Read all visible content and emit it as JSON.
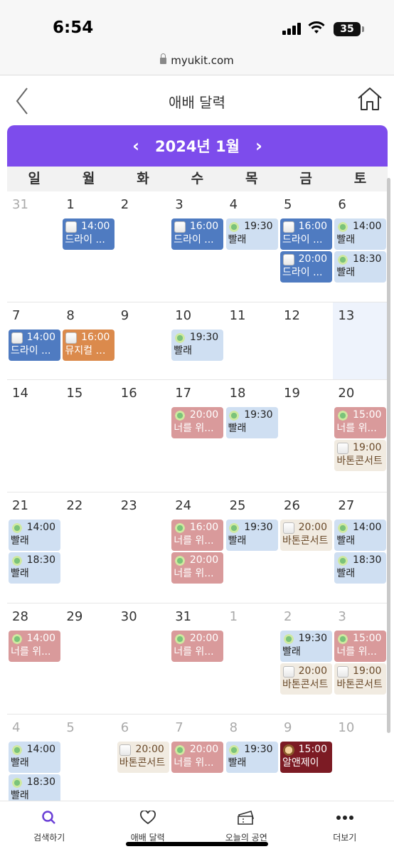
{
  "status": {
    "time": "6:54",
    "battery": "35"
  },
  "browser": {
    "url": "myukit.com"
  },
  "appbar": {
    "title": "애배 달력",
    "back_icon": "chevron-left-icon",
    "home_icon": "home-icon"
  },
  "calendar": {
    "month_label": "2024년 1월",
    "prev": "‹",
    "next": "›",
    "weekdays": [
      "일",
      "월",
      "화",
      "수",
      "목",
      "금",
      "토"
    ],
    "colors": {
      "purple": "#7d4cec",
      "blue_dark": "#4f7bc1",
      "blue_light": "#cfdff2",
      "orange": "#db8a4c",
      "pink": "#d99a9b",
      "beige": "#f1ebe1",
      "maroon": "#7c1b24"
    },
    "weeks": [
      {
        "days": [
          {
            "d": "31",
            "dim": true
          },
          {
            "d": "1"
          },
          {
            "d": "2"
          },
          {
            "d": "3"
          },
          {
            "d": "4"
          },
          {
            "d": "5"
          },
          {
            "d": "6"
          }
        ],
        "events": [
          {
            "col": 1,
            "slot": 0,
            "time": "14:00",
            "name": "드라이 ...",
            "icon": "cup",
            "style": "blue_dark"
          },
          {
            "col": 3,
            "slot": 0,
            "time": "16:00",
            "name": "드라이 ...",
            "icon": "cup",
            "style": "blue_dark"
          },
          {
            "col": 4,
            "slot": 0,
            "time": "19:30",
            "name": "빨래",
            "icon": "fairy",
            "style": "blue_light"
          },
          {
            "col": 5,
            "slot": 0,
            "time": "16:00",
            "name": "드라이 ...",
            "icon": "cup",
            "style": "blue_dark"
          },
          {
            "col": 5,
            "slot": 1,
            "time": "20:00",
            "name": "드라이 ...",
            "icon": "cup",
            "style": "blue_dark"
          },
          {
            "col": 6,
            "slot": 0,
            "time": "14:00",
            "name": "빨래",
            "icon": "fairy",
            "style": "blue_light"
          },
          {
            "col": 6,
            "slot": 1,
            "time": "18:30",
            "name": "빨래",
            "icon": "fairy",
            "style": "blue_light"
          }
        ]
      },
      {
        "days": [
          {
            "d": "7"
          },
          {
            "d": "8"
          },
          {
            "d": "9"
          },
          {
            "d": "10"
          },
          {
            "d": "11"
          },
          {
            "d": "12"
          },
          {
            "d": "13",
            "today": true
          }
        ],
        "events": [
          {
            "col": 0,
            "slot": 0,
            "time": "14:00",
            "name": "드라이 ...",
            "icon": "cup",
            "style": "blue_dark"
          },
          {
            "col": 1,
            "slot": 0,
            "time": "16:00",
            "name": "뮤지컬 <...",
            "icon": "cup",
            "style": "orange"
          },
          {
            "col": 3,
            "slot": 0,
            "time": "19:30",
            "name": "빨래",
            "icon": "fairy",
            "style": "blue_light"
          }
        ]
      },
      {
        "days": [
          {
            "d": "14"
          },
          {
            "d": "15"
          },
          {
            "d": "16"
          },
          {
            "d": "17"
          },
          {
            "d": "18"
          },
          {
            "d": "19"
          },
          {
            "d": "20"
          }
        ],
        "events": [
          {
            "col": 3,
            "slot": 0,
            "time": "20:00",
            "name": "너를 위...",
            "icon": "fairy",
            "style": "pink"
          },
          {
            "col": 4,
            "slot": 0,
            "time": "19:30",
            "name": "빨래",
            "icon": "fairy",
            "style": "blue_light"
          },
          {
            "col": 6,
            "slot": 0,
            "time": "15:00",
            "name": "너를 위...",
            "icon": "fairy",
            "style": "pink"
          },
          {
            "col": 6,
            "slot": 1,
            "time": "19:00",
            "name": "바톤콘서트",
            "icon": "cup",
            "style": "beige"
          }
        ]
      },
      {
        "days": [
          {
            "d": "21"
          },
          {
            "d": "22"
          },
          {
            "d": "23"
          },
          {
            "d": "24"
          },
          {
            "d": "25"
          },
          {
            "d": "26"
          },
          {
            "d": "27"
          }
        ],
        "events": [
          {
            "col": 0,
            "slot": 0,
            "time": "14:00",
            "name": "빨래",
            "icon": "fairy",
            "style": "blue_light"
          },
          {
            "col": 0,
            "slot": 1,
            "time": "18:30",
            "name": "빨래",
            "icon": "fairy",
            "style": "blue_light"
          },
          {
            "col": 3,
            "slot": 0,
            "time": "16:00",
            "name": "너를 위...",
            "icon": "fairy",
            "style": "pink"
          },
          {
            "col": 3,
            "slot": 1,
            "time": "20:00",
            "name": "너를 위...",
            "icon": "fairy",
            "style": "pink"
          },
          {
            "col": 4,
            "slot": 0,
            "time": "19:30",
            "name": "빨래",
            "icon": "fairy",
            "style": "blue_light"
          },
          {
            "col": 5,
            "slot": 0,
            "time": "20:00",
            "name": "바톤콘서트",
            "icon": "cup",
            "style": "beige"
          },
          {
            "col": 6,
            "slot": 0,
            "time": "14:00",
            "name": "빨래",
            "icon": "fairy",
            "style": "blue_light"
          },
          {
            "col": 6,
            "slot": 1,
            "time": "18:30",
            "name": "빨래",
            "icon": "fairy",
            "style": "blue_light"
          }
        ]
      },
      {
        "days": [
          {
            "d": "28"
          },
          {
            "d": "29"
          },
          {
            "d": "30"
          },
          {
            "d": "31"
          },
          {
            "d": "1",
            "dim": true
          },
          {
            "d": "2",
            "dim": true
          },
          {
            "d": "3",
            "dim": true
          }
        ],
        "events": [
          {
            "col": 0,
            "slot": 0,
            "time": "14:00",
            "name": "너를 위...",
            "icon": "fairy",
            "style": "pink"
          },
          {
            "col": 3,
            "slot": 0,
            "time": "20:00",
            "name": "너를 위...",
            "icon": "fairy",
            "style": "pink"
          },
          {
            "col": 5,
            "slot": 0,
            "time": "19:30",
            "name": "빨래",
            "icon": "fairy",
            "style": "blue_light"
          },
          {
            "col": 5,
            "slot": 1,
            "time": "20:00",
            "name": "바톤콘서트",
            "icon": "cup",
            "style": "beige"
          },
          {
            "col": 6,
            "slot": 0,
            "time": "15:00",
            "name": "너를 위...",
            "icon": "fairy",
            "style": "pink"
          },
          {
            "col": 6,
            "slot": 1,
            "time": "19:00",
            "name": "바톤콘서트",
            "icon": "cup",
            "style": "beige"
          }
        ]
      },
      {
        "days": [
          {
            "d": "4",
            "dim": true
          },
          {
            "d": "5",
            "dim": true
          },
          {
            "d": "6",
            "dim": true
          },
          {
            "d": "7",
            "dim": true
          },
          {
            "d": "8",
            "dim": true
          },
          {
            "d": "9",
            "dim": true
          },
          {
            "d": "10",
            "dim": true
          }
        ],
        "events": [
          {
            "col": 0,
            "slot": 0,
            "time": "14:00",
            "name": "빨래",
            "icon": "fairy",
            "style": "blue_light"
          },
          {
            "col": 0,
            "slot": 1,
            "time": "18:30",
            "name": "빨래",
            "icon": "fairy",
            "style": "blue_light"
          },
          {
            "col": 2,
            "slot": 0,
            "time": "20:00",
            "name": "바톤콘서트",
            "icon": "cup",
            "style": "beige"
          },
          {
            "col": 3,
            "slot": 0,
            "time": "20:00",
            "name": "너를 위...",
            "icon": "fairy",
            "style": "pink"
          },
          {
            "col": 4,
            "slot": 0,
            "time": "19:30",
            "name": "빨래",
            "icon": "fairy",
            "style": "blue_light"
          },
          {
            "col": 5,
            "slot": 0,
            "time": "15:00",
            "name": "알앤제이",
            "icon": "dog",
            "style": "maroon"
          }
        ]
      }
    ]
  },
  "tabs": [
    {
      "label": "검색하기",
      "icon": "search-icon"
    },
    {
      "label": "애배 달력",
      "icon": "heart-icon"
    },
    {
      "label": "오늘의 공연",
      "icon": "ticket-icon"
    },
    {
      "label": "더보기",
      "icon": "more-icon"
    }
  ]
}
